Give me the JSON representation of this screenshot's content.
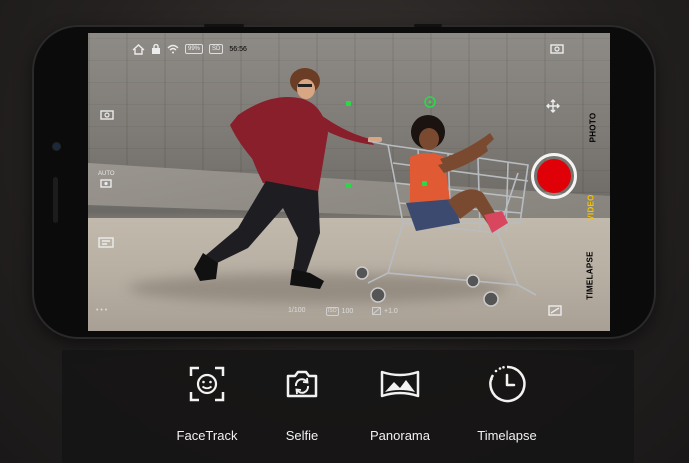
{
  "status_bar": {
    "battery": "99%",
    "storage": "SD",
    "recording_time": "56:56"
  },
  "left_controls": {
    "auto_label": "AUTO"
  },
  "modes": {
    "photo": "PHOTO",
    "video": "VIDEO",
    "timelapse": "TIMELAPSE",
    "active": "VIDEO"
  },
  "bottom_info": {
    "dots": "• • •",
    "shutter": "1/100",
    "iso_tag": "ISO",
    "iso_value": "100",
    "ev_value": "+1.0"
  },
  "colors": {
    "record": "#e00008",
    "active_mode": "#f5c400",
    "focus": "#2cd84a"
  },
  "features": [
    {
      "label": "FaceTrack",
      "icon": "face-track-icon"
    },
    {
      "label": "Selfie",
      "icon": "selfie-camera-icon"
    },
    {
      "label": "Panorama",
      "icon": "panorama-icon"
    },
    {
      "label": "Timelapse",
      "icon": "timelapse-icon"
    }
  ]
}
